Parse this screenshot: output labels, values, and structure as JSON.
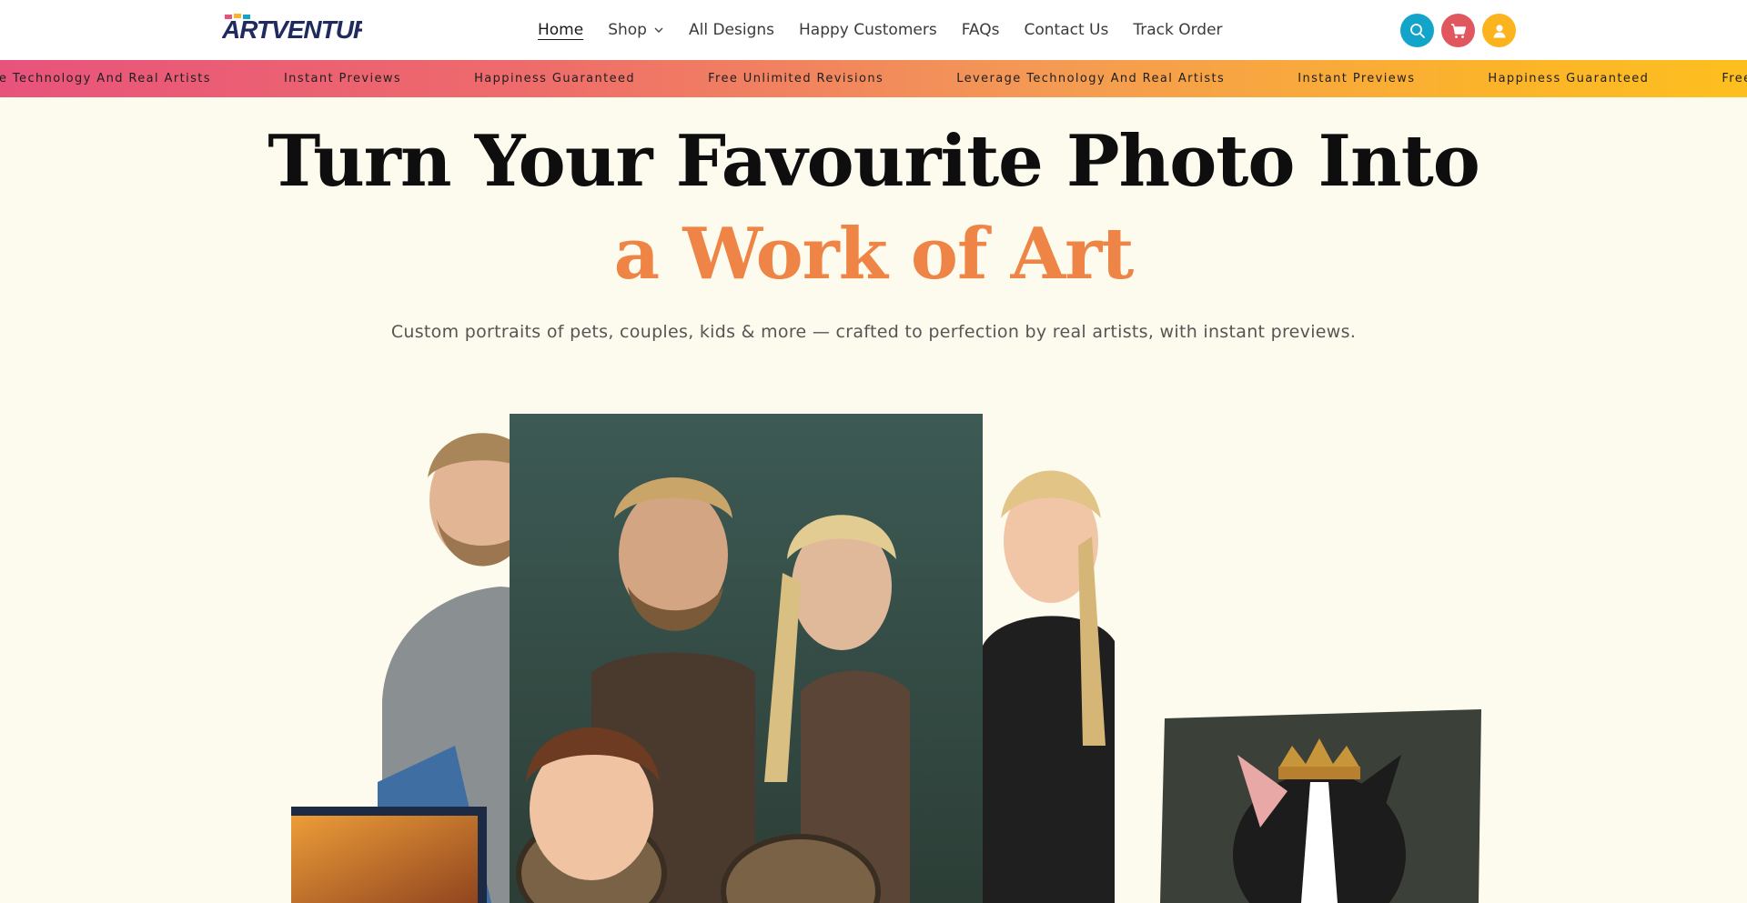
{
  "brand": {
    "logo_text": "ARTVENTURES"
  },
  "nav": {
    "items": [
      {
        "label": "Home",
        "active": true
      },
      {
        "label": "Shop",
        "dropdown": true
      },
      {
        "label": "All Designs"
      },
      {
        "label": "Happy Customers"
      },
      {
        "label": "FAQs"
      },
      {
        "label": "Contact Us"
      },
      {
        "label": "Track Order"
      }
    ]
  },
  "header_icons": {
    "search": {
      "icon": "search-icon",
      "color": "#12a4c9"
    },
    "cart": {
      "icon": "cart-icon",
      "color": "#e0575f"
    },
    "account": {
      "icon": "user-icon",
      "color": "#fbb41e"
    }
  },
  "marquee": {
    "items": [
      "e Technology And Real Artists",
      "Instant Previews",
      "Happiness Guaranteed",
      "Free Unlimited Revisions",
      "Leverage Technology And Real Artists",
      "Instant Previews",
      "Happiness Guaranteed",
      "Free"
    ],
    "gradient": [
      "#e8537c",
      "#fdbf1f"
    ]
  },
  "hero": {
    "title_line1": "Turn Your Favourite Photo Into",
    "title_line2": "a Work of Art",
    "subtitle": "Custom portraits of pets, couples, kids & more — crafted to perfection by real artists, with instant previews.",
    "accent_color": "#ee8546"
  }
}
